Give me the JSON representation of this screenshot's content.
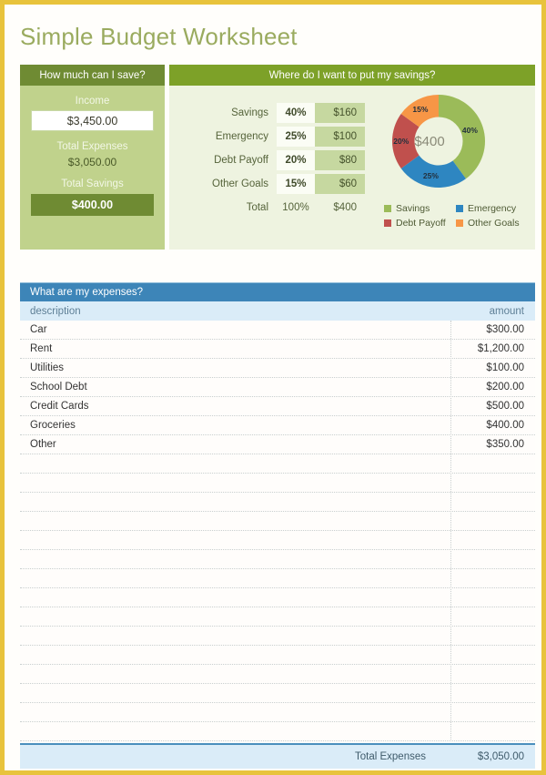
{
  "theme": {
    "border_gold": "#e8c33c",
    "green_dark": "#6f8b33",
    "green_header": "#7da128",
    "green_panel": "#c0d28c",
    "green_light": "#eef3e0",
    "blue_header": "#3d85b8",
    "blue_light": "#daecf8",
    "title_color": "#9aab5f"
  },
  "page_title": "Simple Budget Worksheet",
  "save_panel": {
    "header": "How much can I save?",
    "income_label": "Income",
    "income_value": "$3,450.00",
    "total_expenses_label": "Total Expenses",
    "total_expenses_value": "$3,050.00",
    "total_savings_label": "Total Savings",
    "total_savings_value": "$400.00"
  },
  "savings_panel": {
    "header": "Where do I want to put my savings?",
    "rows": [
      {
        "name": "Savings",
        "percent": "40%",
        "amount": "$160"
      },
      {
        "name": "Emergency",
        "percent": "25%",
        "amount": "$100"
      },
      {
        "name": "Debt Payoff",
        "percent": "20%",
        "amount": "$80"
      },
      {
        "name": "Other Goals",
        "percent": "15%",
        "amount": "$60"
      }
    ],
    "total": {
      "name": "Total",
      "percent": "100%",
      "amount": "$400"
    }
  },
  "chart_data": {
    "type": "pie",
    "title": "Where do I want to put my savings?",
    "center_label": "$400",
    "categories": [
      "Savings",
      "Emergency",
      "Debt Payoff",
      "Other Goals"
    ],
    "values": [
      40,
      25,
      20,
      15
    ],
    "amounts": [
      160,
      100,
      80,
      60
    ],
    "data_labels": [
      "40%",
      "25%",
      "20%",
      "15%"
    ],
    "colors": [
      "#9bbb59",
      "#2e86c1",
      "#c0504d",
      "#f79646"
    ],
    "legend_position": "bottom",
    "hole": 0.52,
    "start_angle": 0,
    "xlabel": "",
    "ylabel": ""
  },
  "expenses": {
    "header": "What are my expenses?",
    "col_description": "description",
    "col_amount": "amount",
    "rows": [
      {
        "description": "Car",
        "amount": "$300.00"
      },
      {
        "description": "Rent",
        "amount": "$1,200.00"
      },
      {
        "description": "Utilities",
        "amount": "$100.00"
      },
      {
        "description": "School Debt",
        "amount": "$200.00"
      },
      {
        "description": "Credit Cards",
        "amount": "$500.00"
      },
      {
        "description": "Groceries",
        "amount": "$400.00"
      },
      {
        "description": "Other",
        "amount": "$350.00"
      }
    ],
    "empty_row_count": 15,
    "total_label": "Total Expenses",
    "total_value": "$3,050.00"
  }
}
